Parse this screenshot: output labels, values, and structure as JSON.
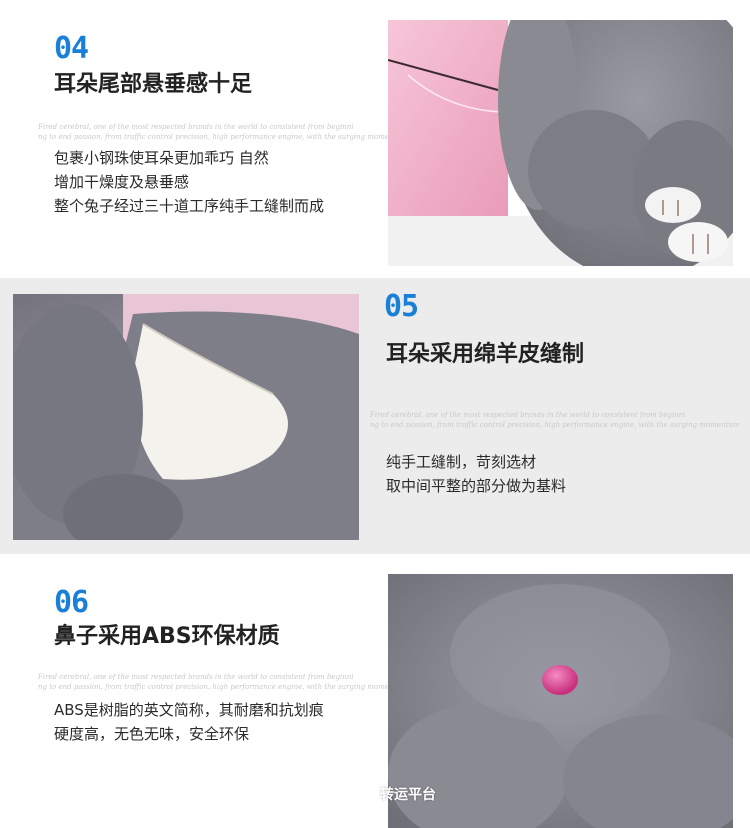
{
  "sections": [
    {
      "number": "04",
      "title": "耳朵尾部悬垂感十足",
      "script_lines": [
        "Fired cerebral, one of the most respected brands in the world to consistent from beginni",
        "ng to end passion, from traffic control precision, high performance engine, with the surging momentum"
      ],
      "lines": [
        "包裹小钢珠使耳朵更加乖巧 自然",
        "增加干燥度及悬垂感",
        "整个兔子经过三十道工序纯手工缝制而成"
      ]
    },
    {
      "number": "05",
      "title": "耳朵采用绵羊皮缝制",
      "script_lines": [
        "Fired cerebral, one of the most respected brands in the world to consistent from beginni",
        "ng to end passion, from traffic control precision, high performance engine, with the surging momentum"
      ],
      "lines": [
        "纯手工缝制，苛刻选材",
        "取中间平整的部分做为基料"
      ]
    },
    {
      "number": "06",
      "title": "鼻子采用ABS环保材质",
      "script_lines": [
        "Fired cerebral, one of the most respected brands in the world to consistent from beginni",
        "ng to end passion, from traffic control precision, high performance engine, with the surging momentum"
      ],
      "lines": [
        "ABS是树脂的英文简称，其耐磨和抗划痕",
        "硬度高，无色无味，安全环保"
      ],
      "watermark": "转运平台"
    }
  ],
  "colors": {
    "number_blue": "#1a7fd6",
    "fur_gray": "#85858d",
    "bag_pink": "#f2b8cc",
    "nose_pink": "#e0509a",
    "leather_white": "#f4f2ec"
  }
}
